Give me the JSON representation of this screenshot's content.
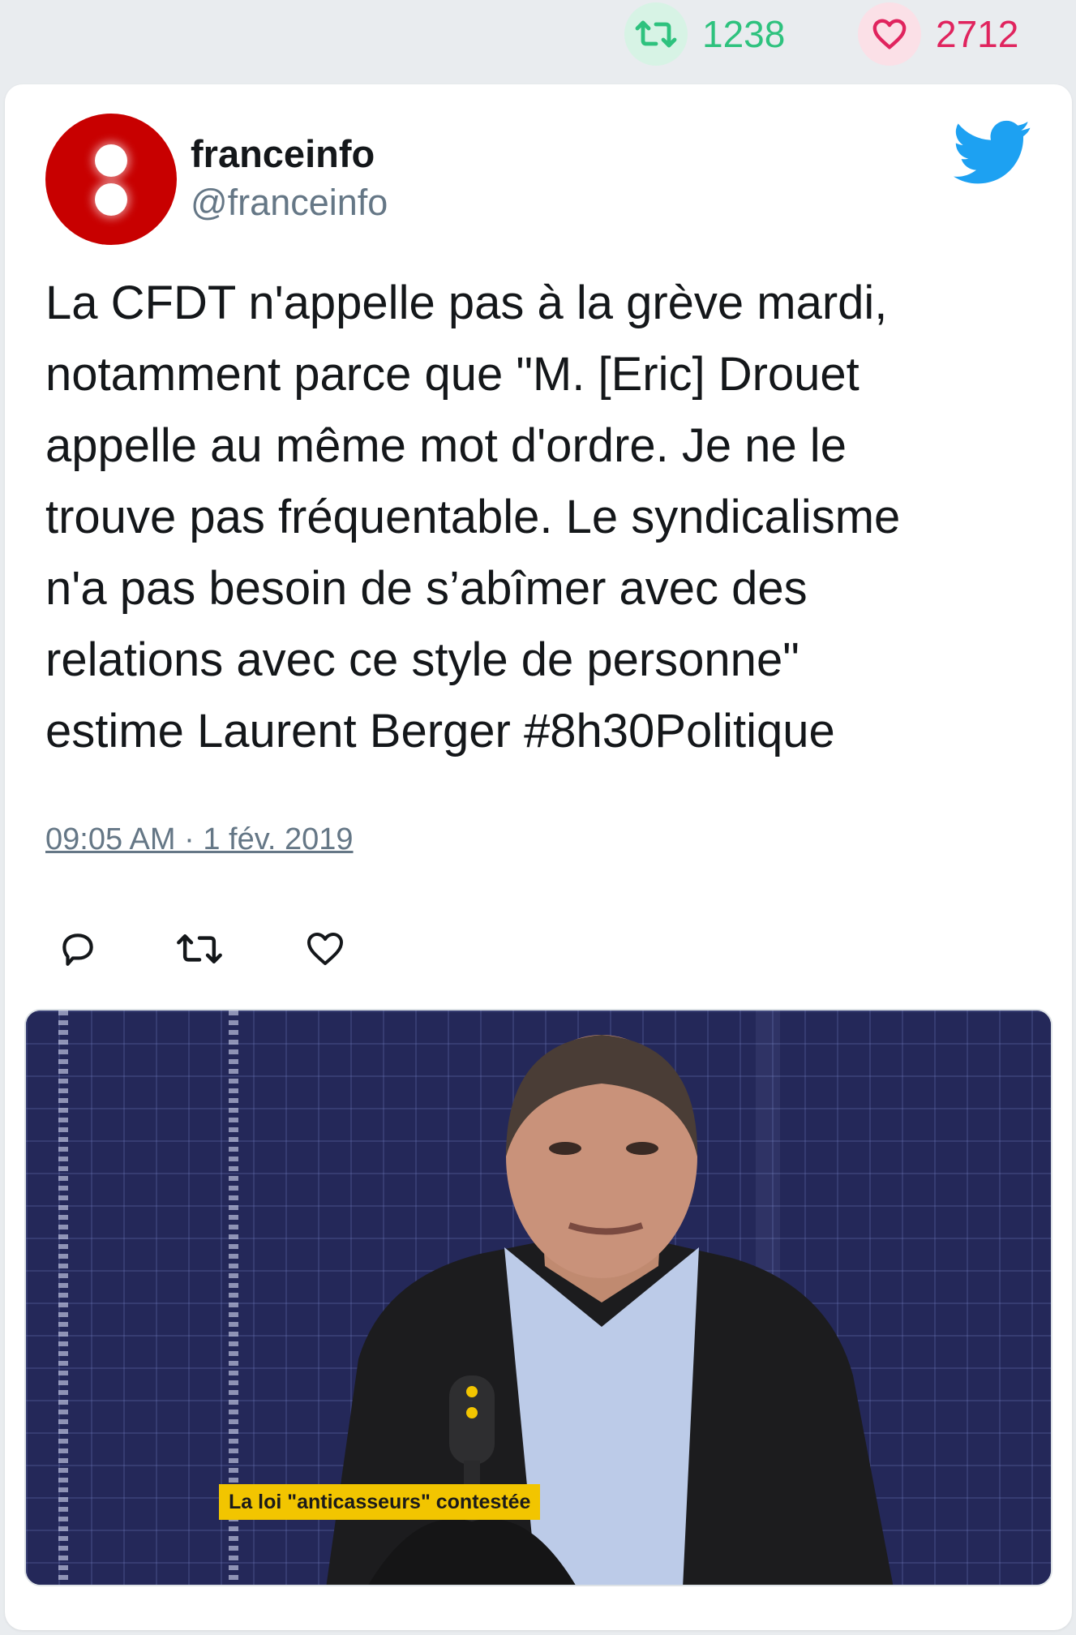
{
  "stats": {
    "retweet_icon": "retweet-icon",
    "retweet_count": "1238",
    "retweet_color": "#2ec27e",
    "like_icon": "heart-icon",
    "like_count": "2712",
    "like_color": "#e0245e"
  },
  "tweet": {
    "display_name": "franceinfo",
    "handle": "@franceinfo",
    "avatar_color": "#c80000",
    "brand_icon": "twitter-bird-icon",
    "brand_color": "#1da1f2",
    "text": "La CFDT n'appelle pas à la grève mardi,\nnotamment parce que \"M. [Eric] Drouet\nappelle au même mot d'ordre. Je ne le\ntrouve pas fréquentable. Le syndicalisme\nn'a pas besoin de s’abîmer avec des\nrelations avec ce style de personne\"\nestime Laurent Berger #8h30Politique",
    "timestamp": "09:05 AM · 1 fév. 2019"
  },
  "actions": {
    "reply_icon": "reply-icon",
    "retweet_icon": "retweet-icon",
    "like_icon": "heart-icon"
  },
  "media": {
    "caption": "La loi \"anticasseurs\" contestée"
  }
}
